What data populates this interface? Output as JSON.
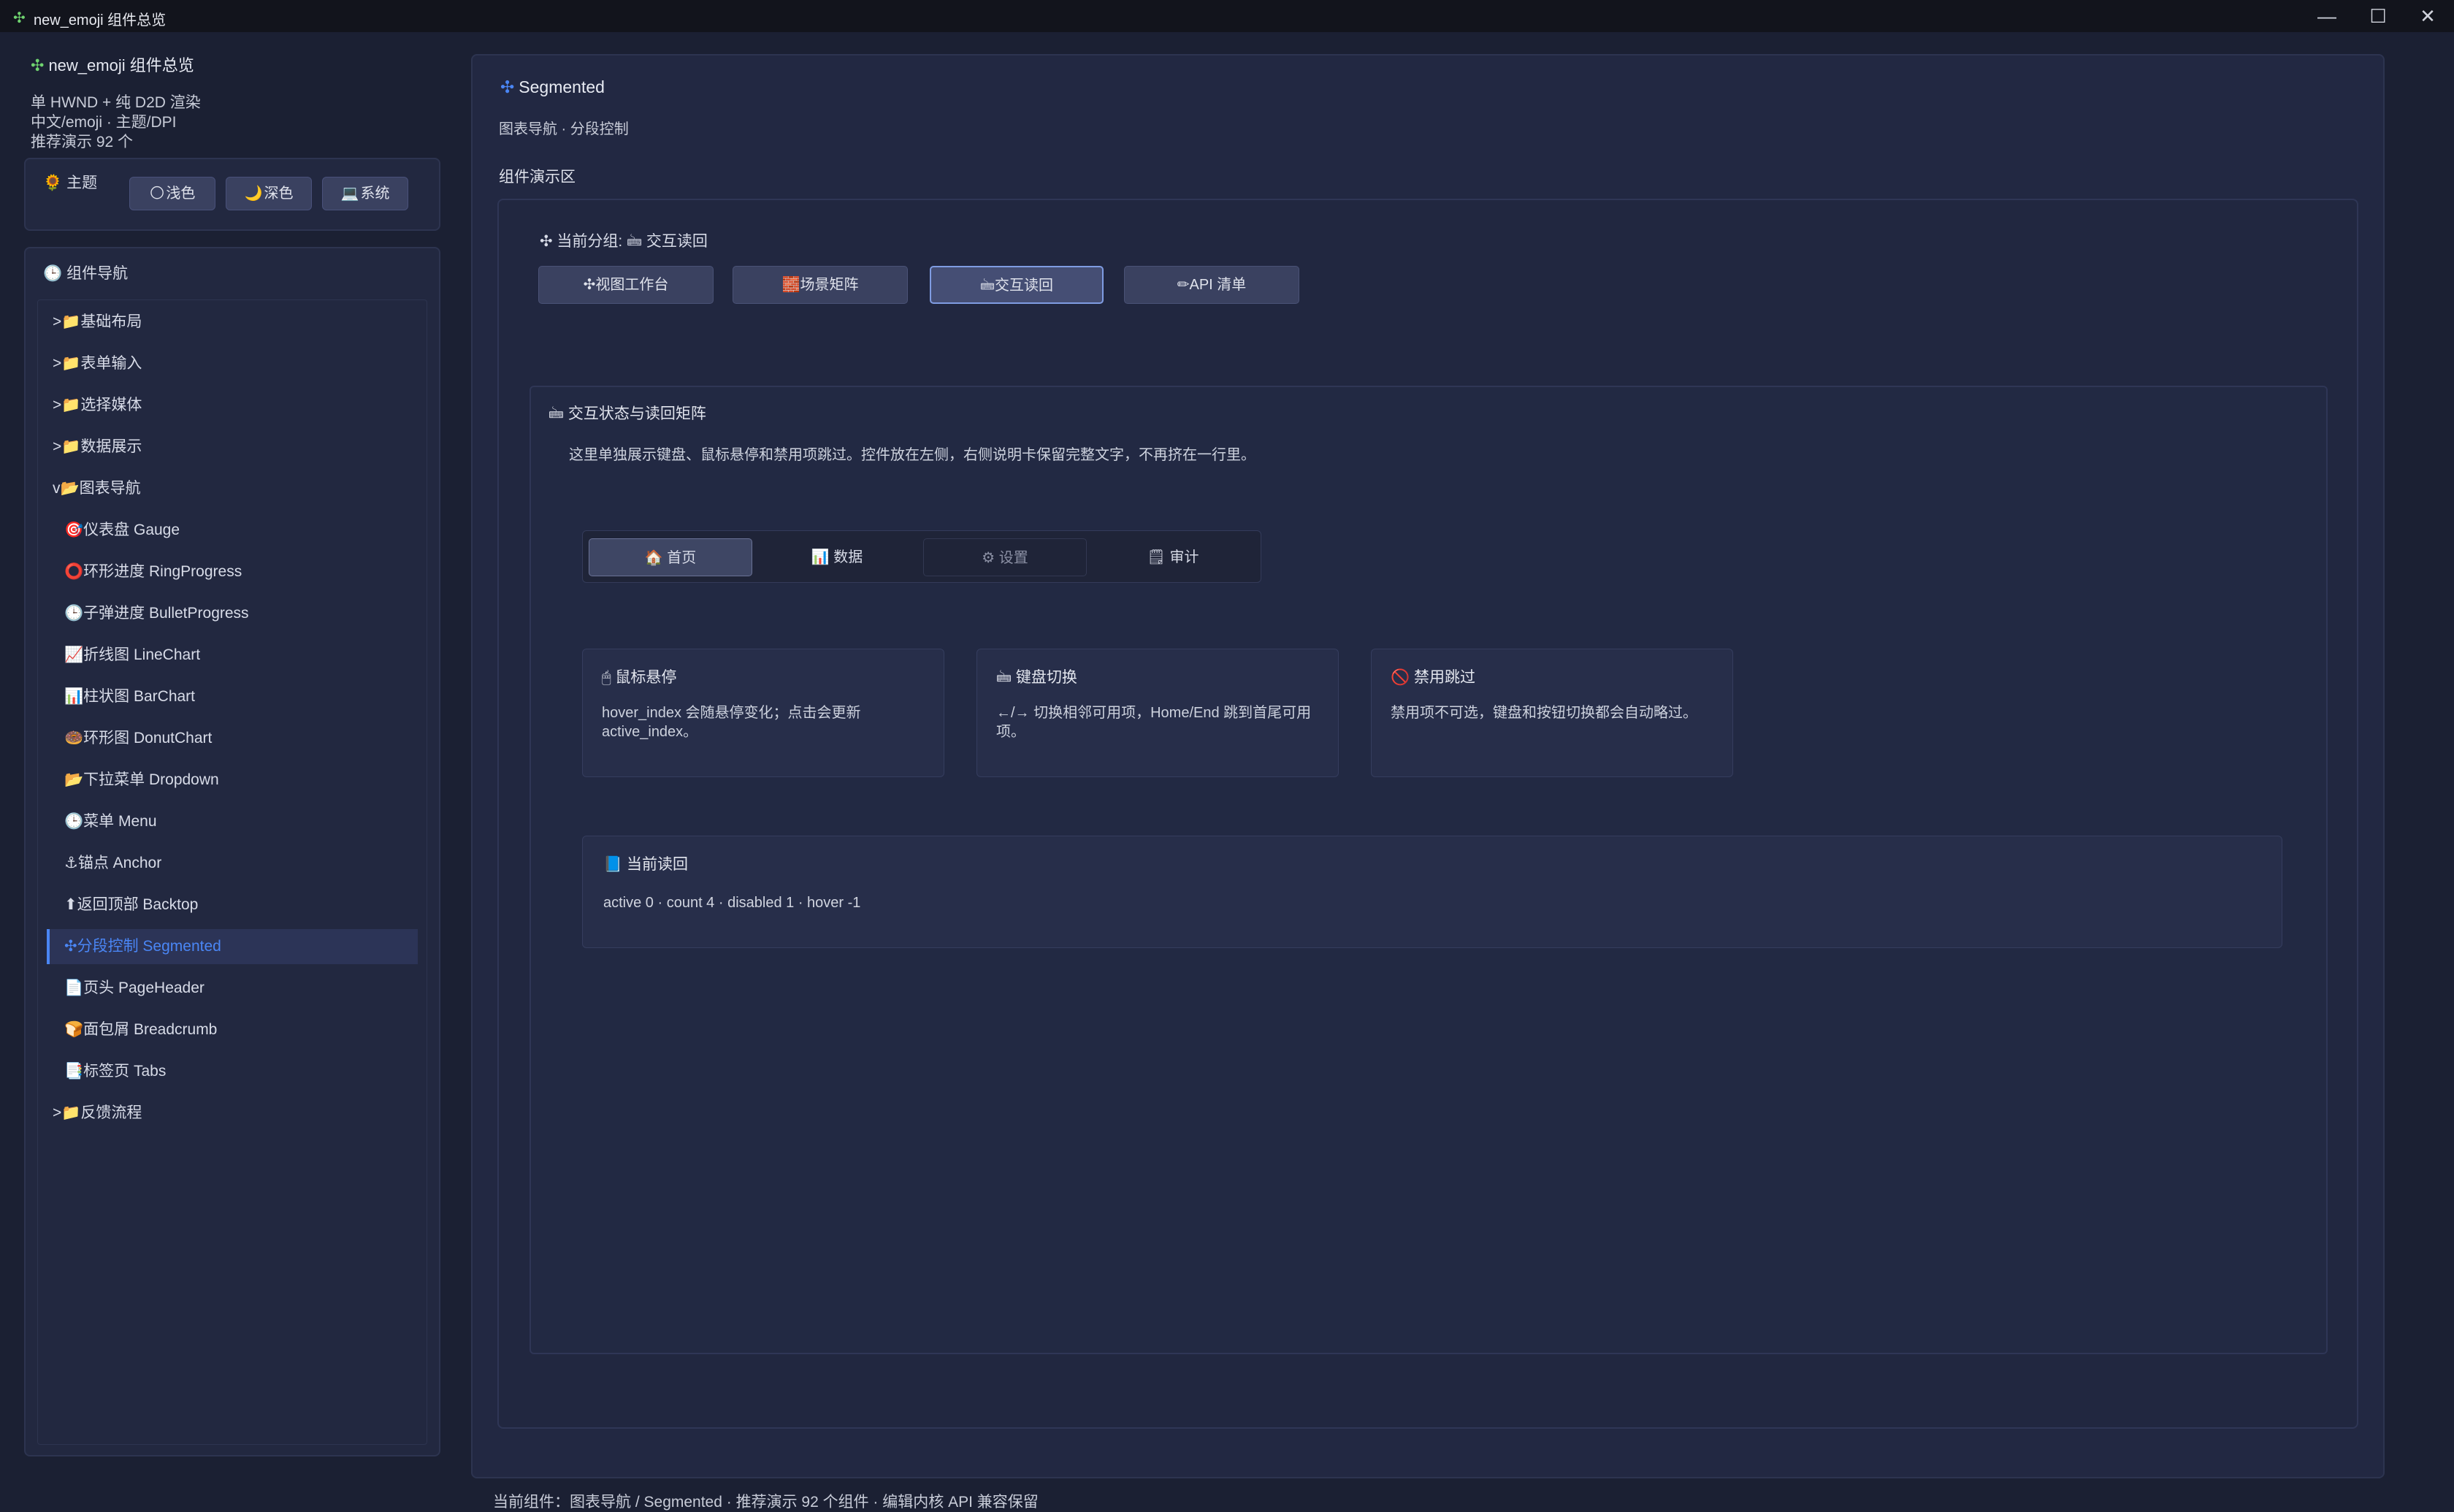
{
  "window": {
    "title": "new_emoji 组件总览",
    "icon": "✣",
    "controls": {
      "minimize": "—",
      "maximize": "☐",
      "close": "✕"
    }
  },
  "header": {
    "icon": "✣",
    "title": "new_emoji 组件总览",
    "lines": [
      "单 HWND + 纯 D2D 渲染",
      "中文/emoji · 主题/DPI",
      "推荐演示 92 个"
    ]
  },
  "theme": {
    "icon": "🌻",
    "title": "主题",
    "buttons": [
      {
        "icon": "🌕",
        "label": "浅色"
      },
      {
        "icon": "🌙",
        "label": "深色"
      },
      {
        "icon": "💻",
        "label": "系统"
      }
    ]
  },
  "nav": {
    "icon": "🕒",
    "title": "组件导航",
    "items": [
      {
        "text": ">📁基础布局",
        "active": false
      },
      {
        "text": ">📁表单输入",
        "active": false
      },
      {
        "text": ">📁选择媒体",
        "active": false
      },
      {
        "text": ">📁数据展示",
        "active": false
      },
      {
        "text": "v📂图表导航",
        "active": false
      },
      {
        "text": "🎯仪表盘 Gauge",
        "active": false,
        "indent": true
      },
      {
        "text": "⭕环形进度 RingProgress",
        "active": false,
        "indent": true
      },
      {
        "text": "🕒子弹进度 BulletProgress",
        "active": false,
        "indent": true
      },
      {
        "text": "📈折线图 LineChart",
        "active": false,
        "indent": true
      },
      {
        "text": "📊柱状图 BarChart",
        "active": false,
        "indent": true
      },
      {
        "text": "🍩环形图 DonutChart",
        "active": false,
        "indent": true
      },
      {
        "text": "📂下拉菜单 Dropdown",
        "active": false,
        "indent": true
      },
      {
        "text": "🕒菜单 Menu",
        "active": false,
        "indent": true
      },
      {
        "text": "⚓锚点 Anchor",
        "active": false,
        "indent": true
      },
      {
        "text": "⬆返回顶部 Backtop",
        "active": false,
        "indent": true
      },
      {
        "text": "✣分段控制 Segmented",
        "active": true,
        "indent": true
      },
      {
        "text": "📄页头 PageHeader",
        "active": false,
        "indent": true
      },
      {
        "text": "🍞面包屑 Breadcrumb",
        "active": false,
        "indent": true
      },
      {
        "text": "📑标签页 Tabs",
        "active": false,
        "indent": true
      },
      {
        "text": ">📁反馈流程",
        "active": false
      }
    ]
  },
  "main": {
    "title_icon": "✣",
    "title": "Segmented",
    "subtitle": "图表导航 · 分段控制",
    "demo_label": "组件演示区",
    "group_label": "✣ 当前分组: 🖮 交互读回",
    "group_buttons": [
      {
        "label": "✣视图工作台",
        "active": false
      },
      {
        "label": "🧱场景矩阵",
        "active": false
      },
      {
        "label": "🖮交互读回",
        "active": true
      },
      {
        "label": "✏API 清单",
        "active": false
      }
    ],
    "card": {
      "title": "🖮 交互状态与读回矩阵",
      "desc": "这里单独展示键盘、鼠标悬停和禁用项跳过。控件放在左侧，右侧说明卡保留完整文字，不再挤在一行里。",
      "segmented": [
        {
          "label": "🏠 首页",
          "state": "selected"
        },
        {
          "label": "📊 数据",
          "state": "normal"
        },
        {
          "label": "⚙ 设置",
          "state": "disabled"
        },
        {
          "label": "🗒 审计",
          "state": "normal"
        }
      ],
      "info_cards": [
        {
          "title": "🖱 鼠标悬停",
          "desc": "hover_index 会随悬停变化；点击会更新 active_index。"
        },
        {
          "title": "🖮 键盘切换",
          "desc": "←/→ 切换相邻可用项，Home/End 跳到首尾可用项。"
        },
        {
          "title": "🚫 禁用跳过",
          "desc": "禁用项不可选，键盘和按钮切换都会自动略过。"
        }
      ],
      "readout": {
        "title": "📘 当前读回",
        "value": "active 0 · count 4 · disabled 1 · hover -1"
      }
    }
  },
  "status_bar": "当前组件：图表导航 / Segmented · 推荐演示 92 个组件 · 编辑内核 API 兼容保留"
}
